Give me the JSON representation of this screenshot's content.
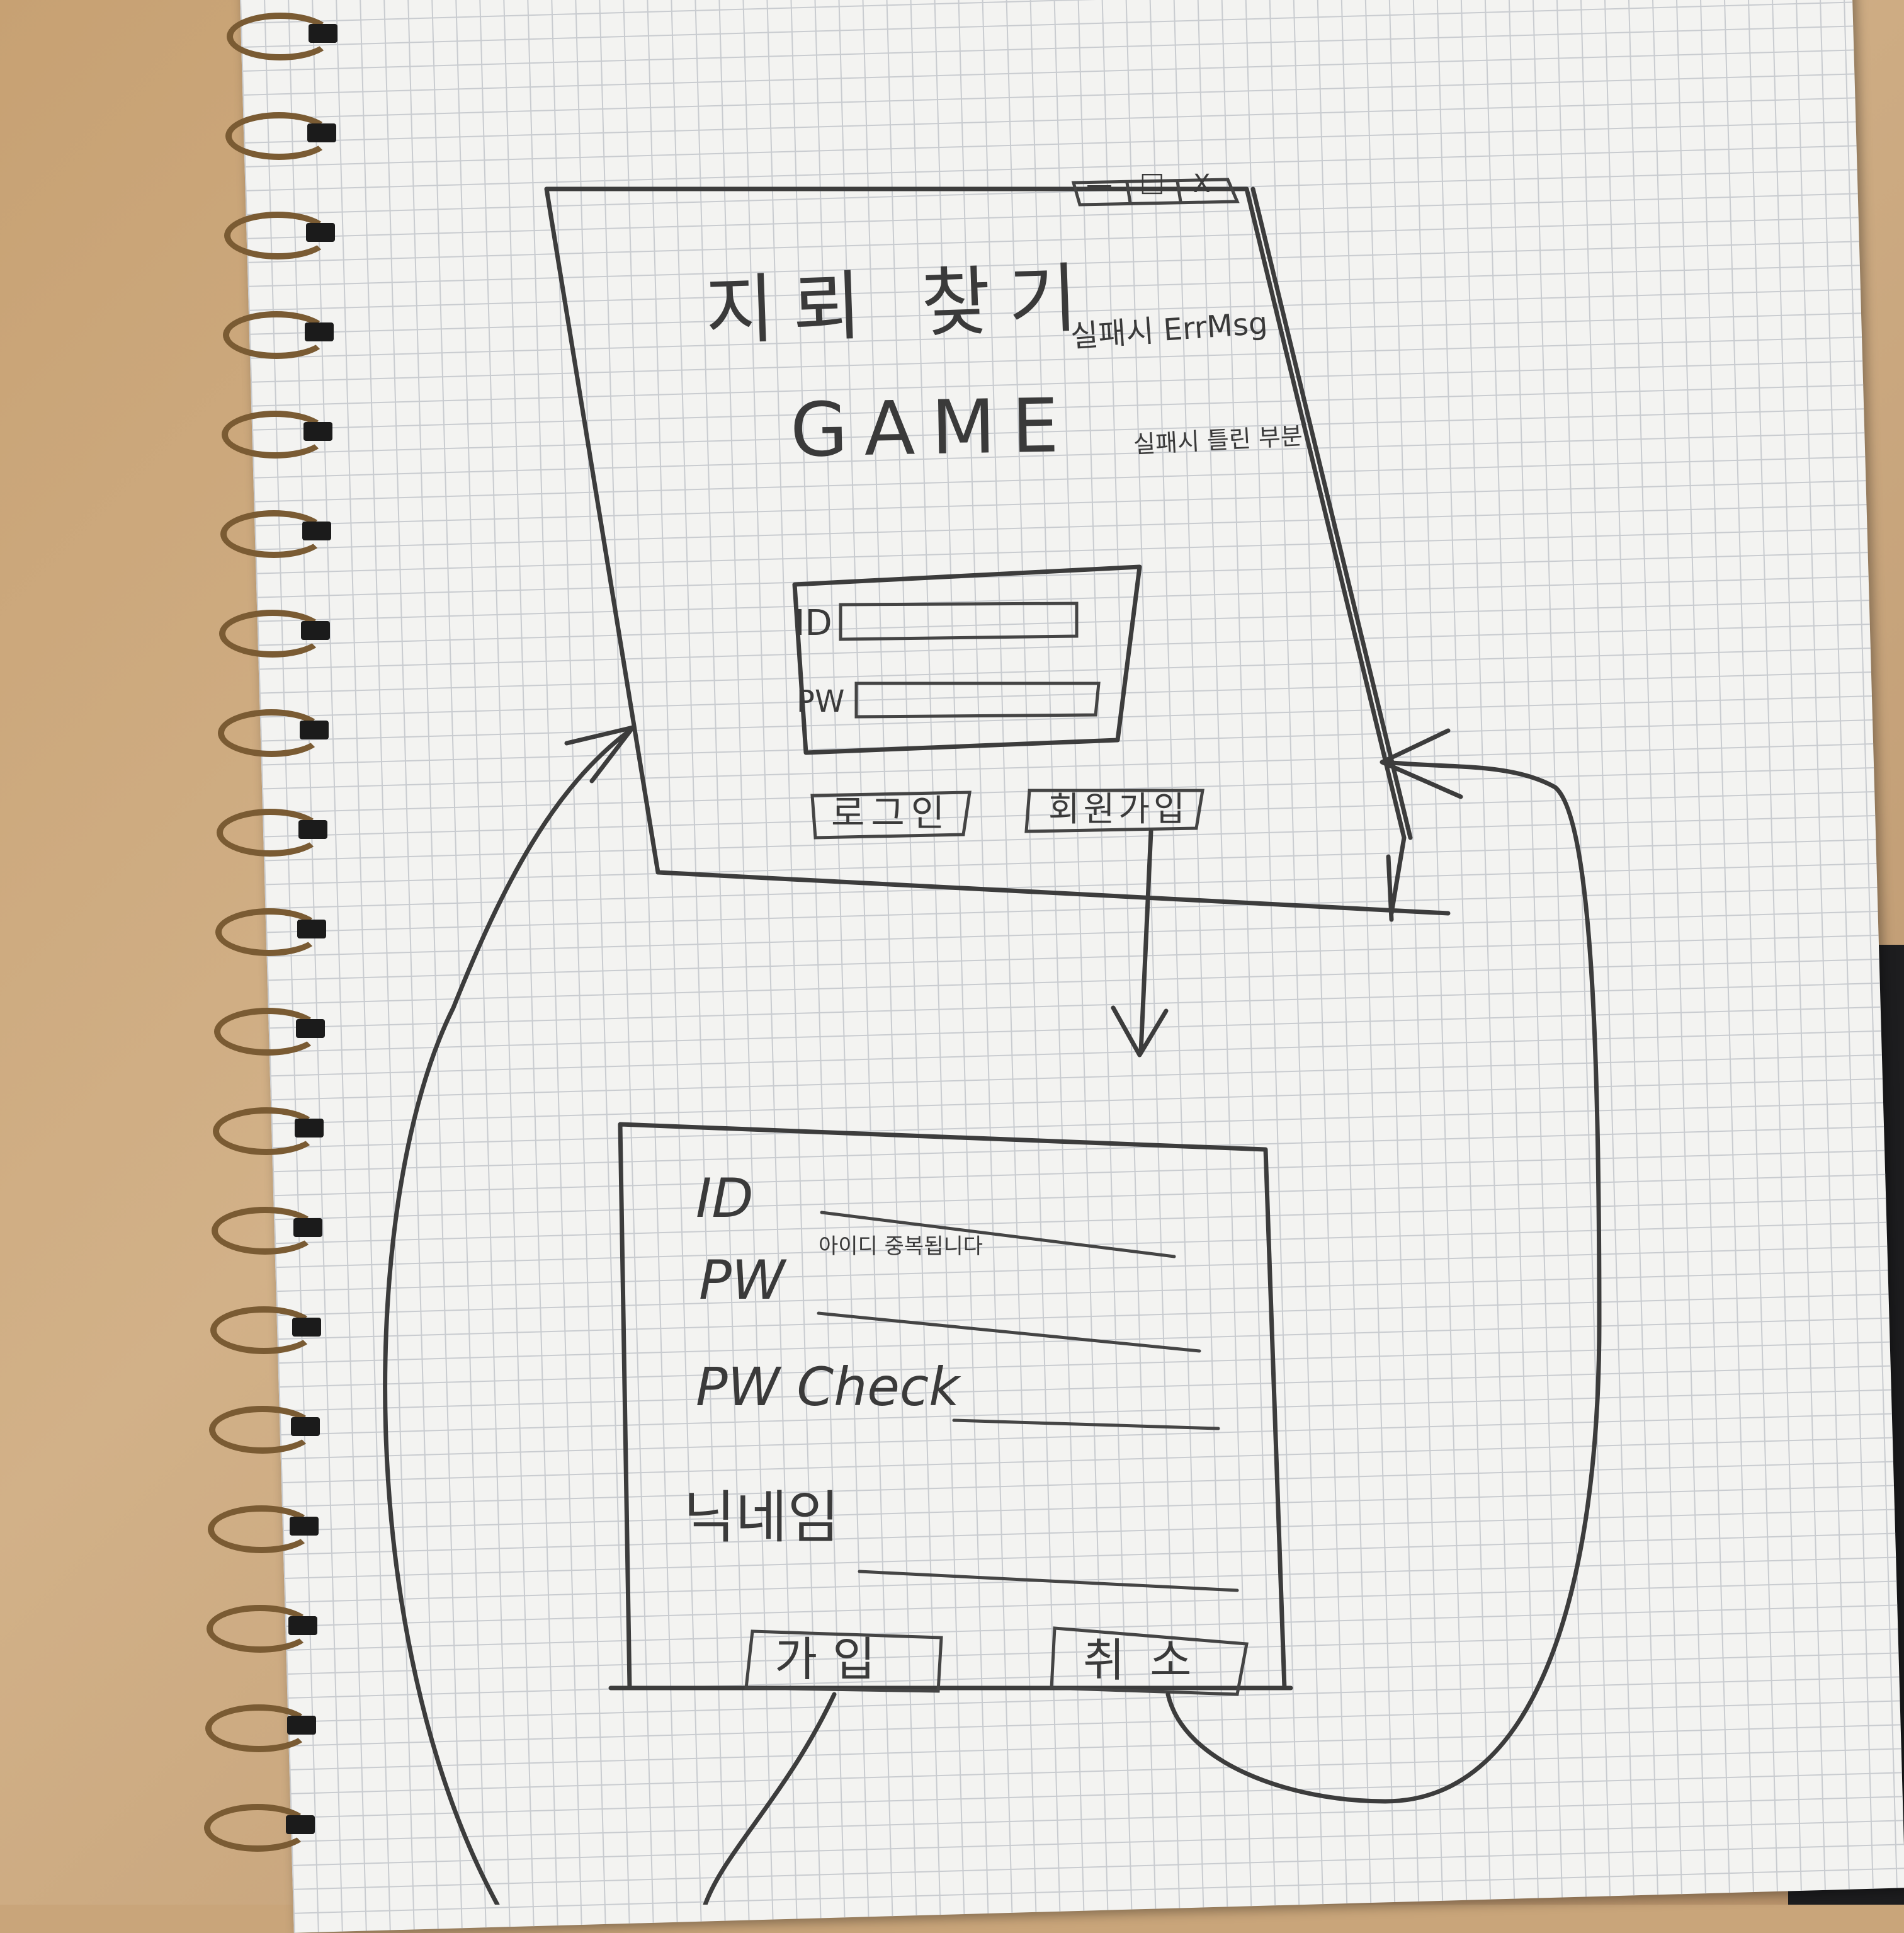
{
  "login_window": {
    "titlebar_buttons": {
      "minimize": "—",
      "maximize": "□",
      "close": "X"
    },
    "title": "지뢰 찾기",
    "subtitle": "GAME",
    "label_success": "실패시 ErrMsg",
    "label_fail": "실패시 틀린 부분",
    "id_label": "ID",
    "pw_label": "PW",
    "login_button": "로그인",
    "signup_button": "회원가입"
  },
  "signup_window": {
    "id_label": "ID",
    "id_error": "아이디 중복됩니다",
    "pw_label": "PW",
    "pw_check_label": "PW Check",
    "nickname_label": "닉네임",
    "join_button": "가입",
    "cancel_button": "취소"
  },
  "colors": {
    "pencil": "#3c3c3c",
    "paper": "#f3f3f1",
    "grid": "#c9ccd0",
    "desk": "#c9a57a"
  }
}
